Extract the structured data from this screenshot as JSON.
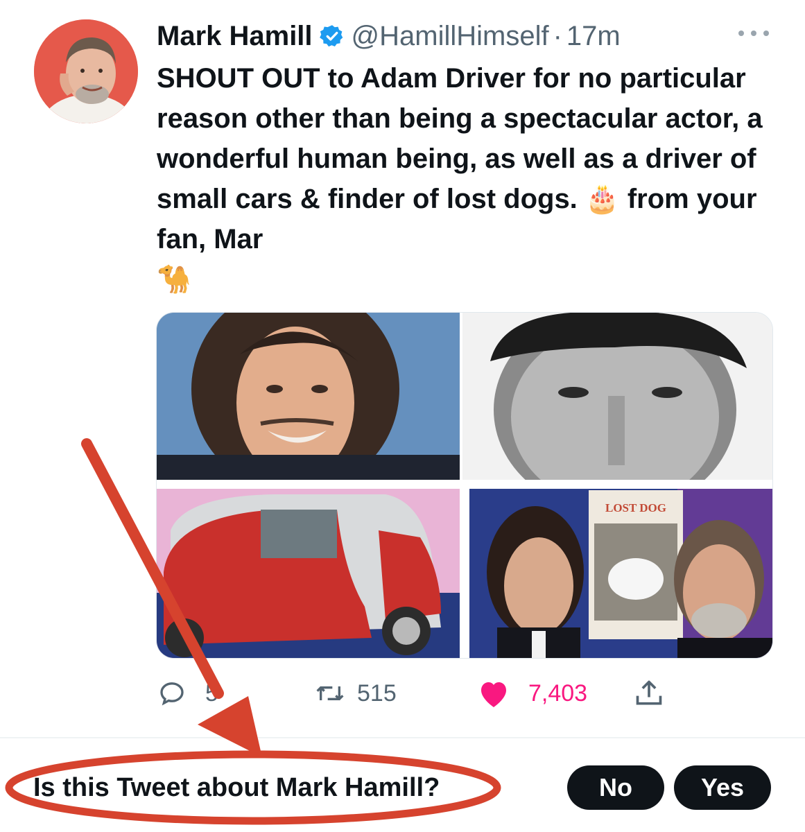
{
  "tweet": {
    "author_name": "Mark Hamill",
    "handle": "@HamillHimself",
    "separator": "·",
    "time": "17m",
    "text_main": "SHOUT OUT to Adam Driver for no particular reason other than being a spectacular actor, a wonderful human being, as well as a driver of small cars & finder of lost dogs.",
    "text_emoji_cake": "🎂",
    "text_tail": "from your fan, Mar",
    "text_emoji_camel": "🐪",
    "media": {
      "lost_dog_sign": "LOST DOG"
    }
  },
  "actions": {
    "reply_count": "5",
    "retweet_count": "515",
    "like_count": "7,403"
  },
  "prompt": {
    "question": "Is this Tweet about Mark Hamill?",
    "no_label": "No",
    "yes_label": "Yes"
  },
  "icons": {
    "verified": "verified-badge-icon",
    "more": "more-horizontal-icon",
    "reply": "reply-icon",
    "retweet": "retweet-icon",
    "like": "heart-icon",
    "share": "share-icon"
  },
  "colors": {
    "verified_blue": "#1d9bf0",
    "like_pink": "#f91880",
    "secondary_text": "#536471",
    "annotation_red": "#d6432e",
    "button_bg": "#0f1419"
  }
}
